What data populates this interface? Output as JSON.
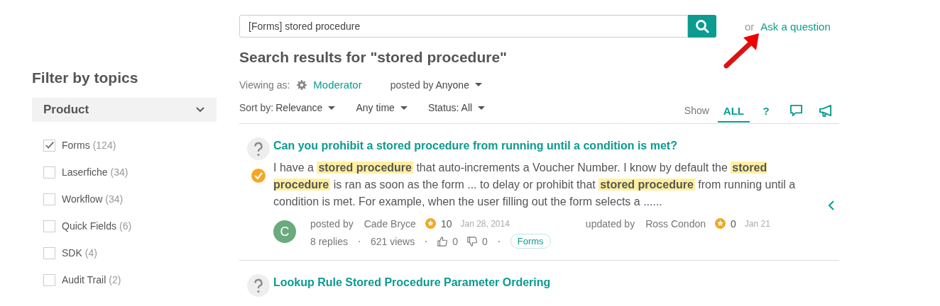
{
  "search": {
    "value": "[Forms] stored procedure"
  },
  "ask": {
    "prefix": "or",
    "link": "Ask a question"
  },
  "heading": "Search results for \"stored procedure\"",
  "viewing": {
    "label": "Viewing as:",
    "role": "Moderator",
    "posted_label": "posted by",
    "posted_value": "Anyone"
  },
  "sort": {
    "label": "Sort by:",
    "value": "Relevance"
  },
  "filters": [
    "Any time",
    "Status: All"
  ],
  "show": {
    "label": "Show",
    "tabs": [
      {
        "kind": "text",
        "label": "ALL",
        "selected": true
      },
      {
        "kind": "text",
        "label": "?",
        "selected": false
      },
      {
        "kind": "chat",
        "selected": false
      },
      {
        "kind": "announce",
        "selected": false
      }
    ]
  },
  "sidebar": {
    "title": "Filter by topics",
    "group": {
      "label": "Product",
      "expanded": true
    },
    "topics": [
      {
        "label": "Forms",
        "count": "(124)",
        "checked": true
      },
      {
        "label": "Laserfiche",
        "count": "(34)",
        "checked": false
      },
      {
        "label": "Workflow",
        "count": "(34)",
        "checked": false
      },
      {
        "label": "Quick Fields",
        "count": "(6)",
        "checked": false
      },
      {
        "label": "SDK",
        "count": "(4)",
        "checked": false
      },
      {
        "label": "Audit Trail",
        "count": "(2)",
        "checked": false
      }
    ]
  },
  "results": [
    {
      "title": "Can you prohibit a stored procedure from running until a condition is met?",
      "answered": true,
      "excerpt": "I have a **stored procedure** that auto-increments a Voucher Number.  I know by default the **stored procedure** is ran as soon as the form ... to delay or prohibit that **stored procedure** from running until a condition is met.  For example, when the user filling out the form selects a ......",
      "meta": {
        "avatar": "C",
        "posted_label": "posted by",
        "author": "Cade Bryce",
        "author_points": "10",
        "posted_date": "Jan 28, 2014",
        "updated_label": "updated by",
        "updater": "Ross Condon",
        "updater_points": "0",
        "updated_date": "Jan 21",
        "replies": "8 replies",
        "views": "621 views",
        "up": "0",
        "down": "0",
        "tag": "Forms"
      }
    },
    {
      "title": "Lookup Rule Stored Procedure Parameter Ordering",
      "answered": false
    }
  ]
}
